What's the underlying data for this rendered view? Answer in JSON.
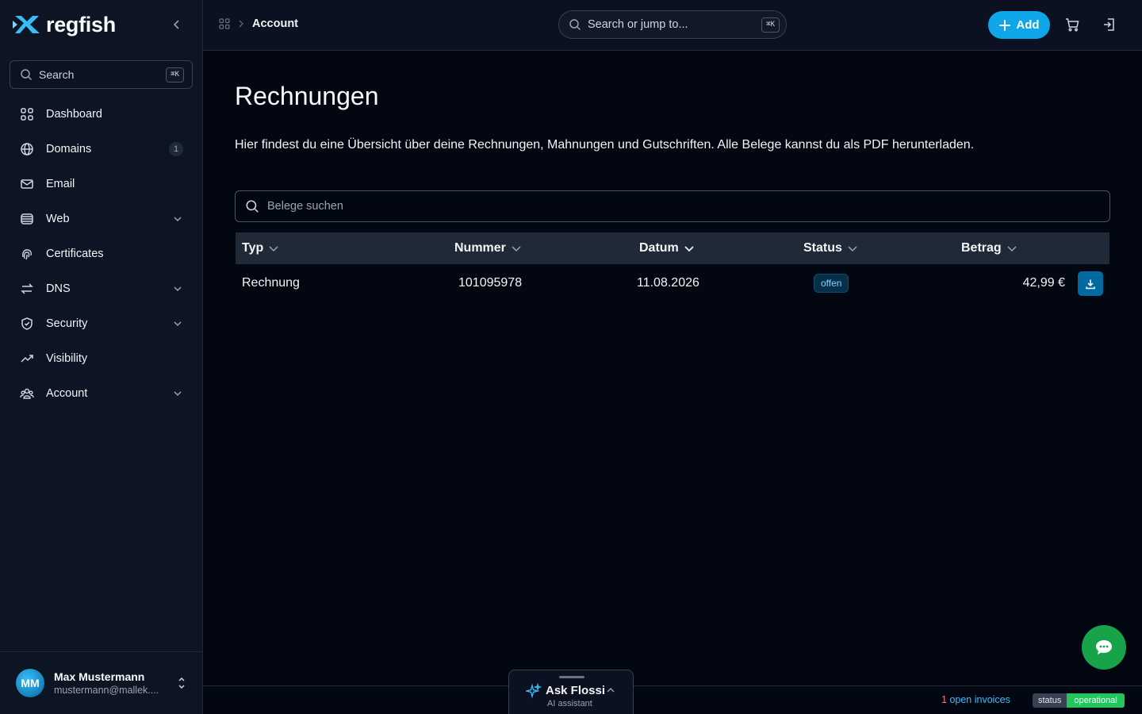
{
  "brand": {
    "name": "regfish",
    "accent": "#38bdf8"
  },
  "sidebar": {
    "search_label": "Search",
    "shortcut": "⌘K",
    "items": [
      {
        "label": "Dashboard",
        "icon": "grid-icon"
      },
      {
        "label": "Domains",
        "icon": "globe-icon",
        "badge": "1"
      },
      {
        "label": "Email",
        "icon": "mail-icon"
      },
      {
        "label": "Web",
        "icon": "server-icon",
        "expandable": true
      },
      {
        "label": "Certificates",
        "icon": "fingerprint-icon"
      },
      {
        "label": "DNS",
        "icon": "arrows-exchange-icon",
        "expandable": true
      },
      {
        "label": "Security",
        "icon": "shield-icon",
        "expandable": true
      },
      {
        "label": "Visibility",
        "icon": "trend-up-icon"
      },
      {
        "label": "Account",
        "icon": "users-icon",
        "expandable": true
      }
    ],
    "user": {
      "initials": "MM",
      "name": "Max Mustermann",
      "email": "mustermann@mallek...."
    }
  },
  "topbar": {
    "breadcrumb_current": "Account",
    "search_placeholder": "Search or jump to...",
    "shortcut": "⌘K",
    "add_label": "Add"
  },
  "main": {
    "title": "Rechnungen",
    "description": "Hier findest du eine Übersicht über deine Rechnungen, Mahnungen und Gutschriften. Alle Belege kannst du als PDF herunterladen.",
    "search_placeholder": "Belege suchen",
    "columns": [
      "Typ",
      "Nummer",
      "Datum",
      "Status",
      "Betrag"
    ],
    "rows": [
      {
        "typ": "Rechnung",
        "nummer": "101095978",
        "datum": "11.08.2026",
        "status": "offen",
        "betrag": "42,99 €"
      }
    ]
  },
  "footer": {
    "open_invoices_count": "1",
    "open_invoices_label": "open invoices",
    "status_label": "status",
    "status_value": "operational"
  },
  "assistant": {
    "title": "Ask Flossi",
    "subtitle": "AI assistant"
  }
}
